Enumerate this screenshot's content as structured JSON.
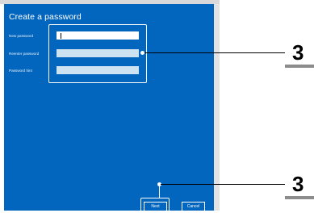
{
  "dialog": {
    "title": "Create a password",
    "fields": [
      {
        "label": "New password",
        "value": ""
      },
      {
        "label": "Reenter password",
        "value": ""
      },
      {
        "label": "Password hint",
        "value": ""
      }
    ],
    "buttons": {
      "next": "Next",
      "cancel": "Cancel"
    }
  },
  "callouts": [
    "3",
    "3"
  ],
  "colors": {
    "dialog_bg": "#0266bf",
    "field_inactive": "#cde3f2",
    "highlight": "#ffffff"
  }
}
